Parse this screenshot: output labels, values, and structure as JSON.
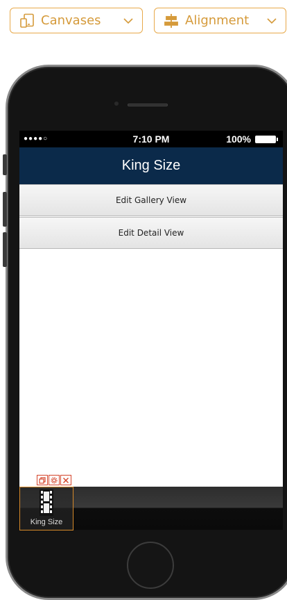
{
  "toolbar": {
    "canvases_label": "Canvases",
    "alignment_label": "Alignment",
    "accent_color": "#d59a3a"
  },
  "device": {
    "status_bar": {
      "signal": "●●●●○",
      "time": "7:10 PM",
      "battery": "100%"
    },
    "nav_title": "King Size",
    "nav_color": "#0b2a4a",
    "rows": [
      {
        "label": "Edit Gallery View"
      },
      {
        "label": "Edit Detail View"
      }
    ],
    "tab_item": {
      "label": "King Size",
      "icon": "film-strip-icon",
      "selected_color": "#d78a2a"
    },
    "tab_tools": [
      "copy-icon",
      "gear-icon",
      "close-icon"
    ]
  }
}
